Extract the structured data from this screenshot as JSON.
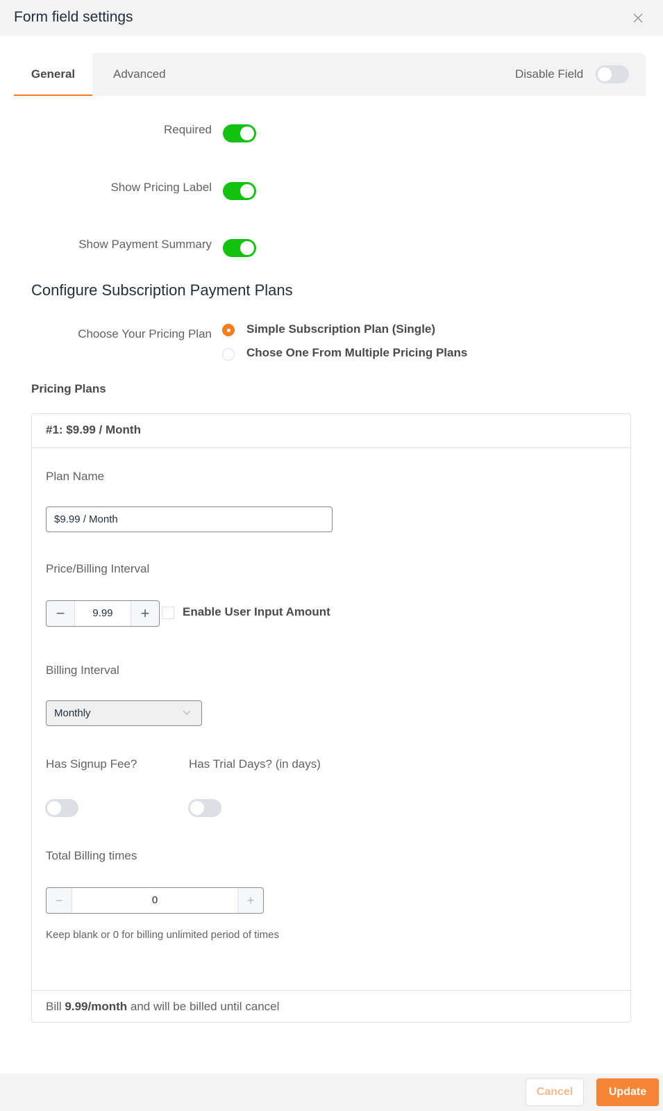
{
  "dialog": {
    "title": "Form field settings",
    "close_icon": "close-icon"
  },
  "tabs": [
    {
      "label": "General",
      "active": true
    },
    {
      "label": "Advanced",
      "active": false
    }
  ],
  "disable_field": {
    "label": "Disable Field",
    "on": false
  },
  "settings": [
    {
      "label": "Required",
      "on": true
    },
    {
      "label": "Show Pricing Label",
      "on": true
    },
    {
      "label": "Show Payment Summary",
      "on": true
    }
  ],
  "colors": {
    "accent": "#f57c20",
    "toggle_on": "#13c20f",
    "toggle_off": "#dcdfe6",
    "update_button": "#f78536"
  },
  "section": {
    "title": "Configure Subscription Payment Plans",
    "pricing_plan_label": "Choose Your Pricing Plan",
    "pricing_plan_options": [
      {
        "label": "Simple Subscription Plan (Single)",
        "checked": true
      },
      {
        "label": "Chose One From Multiple Pricing Plans",
        "checked": false
      }
    ],
    "pricing_plans_heading": "Pricing Plans"
  },
  "plan": {
    "header": "#1: $9.99 / Month",
    "plan_name_label": "Plan Name",
    "plan_name_value": "$9.99 / Month",
    "price_label": "Price/Billing Interval",
    "price_value": "9.99",
    "minus_symbol": "−",
    "plus_symbol": "+",
    "enable_user_input_label": "Enable User Input Amount",
    "enable_user_input_checked": false,
    "billing_interval_label": "Billing Interval",
    "billing_interval_value": "Monthly",
    "signup_fee_label": "Has Signup Fee?",
    "signup_fee_on": false,
    "trial_days_label": "Has Trial Days? (in days)",
    "trial_days_on": false,
    "total_billing_label": "Total Billing times",
    "total_billing_value": "0",
    "total_billing_hint": "Keep blank or 0 for billing unlimited period of times",
    "summary_prefix": "Bill",
    "summary_amount": "9.99/month",
    "summary_suffix": "and will be billed until cancel"
  },
  "footer": {
    "cancel_label": "Cancel",
    "update_label": "Update"
  }
}
